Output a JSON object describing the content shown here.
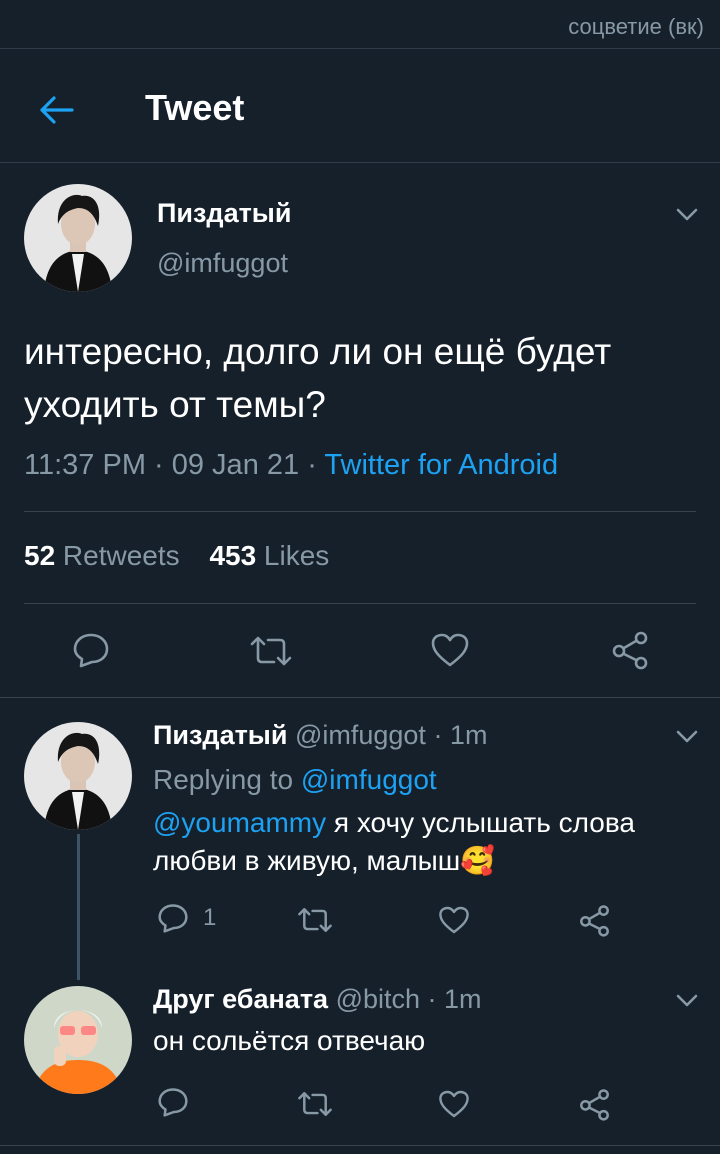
{
  "watermark": "соцветие (вк)",
  "header": {
    "title": "Tweet"
  },
  "main_tweet": {
    "author_name": "Пиздатый",
    "author_handle": "@imfuggot",
    "text": "интересно, долго ли он ещё будет уходить от темы?",
    "time": "11:37 PM · 09 Jan 21 · ",
    "source": "Twitter for Android",
    "retweets_count": "52",
    "retweets_label": " Retweets",
    "likes_count": "453",
    "likes_label": " Likes"
  },
  "replies": [
    {
      "author_name": "Пиздатый",
      "author_meta": " @imfuggot · 1m",
      "replying_prefix": "Replying to ",
      "replying_handle": "@imfuggot",
      "mention": "@youmammy",
      "text": " я хочу услышать слова любви в живую, малыш",
      "emoji": "🥰",
      "reply_count": "1"
    },
    {
      "author_name": "Друг ебаната",
      "author_meta": " @bitch · 1m",
      "text": "он сольётся отвечаю"
    }
  ],
  "colors": {
    "background": "#15202b",
    "accent": "#1da1f2",
    "muted": "#8899a6",
    "divider": "#38444d"
  },
  "icons": [
    "back-arrow-icon",
    "chevron-down-icon",
    "reply-icon",
    "retweet-icon",
    "like-icon",
    "share-icon"
  ]
}
